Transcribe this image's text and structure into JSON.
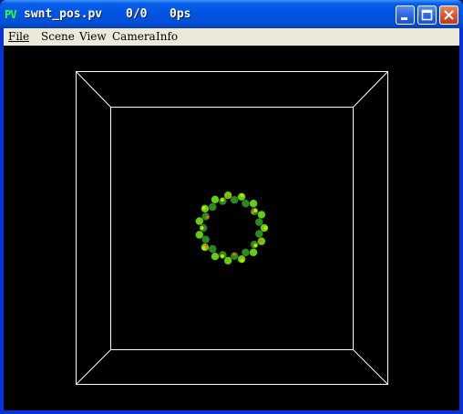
{
  "window": {
    "app_icon_text": "PV",
    "title": "swnt_pos.pv",
    "frame": "0/0",
    "time": "0ps"
  },
  "menu": {
    "items": [
      {
        "label": "File"
      },
      {
        "label": "Scene"
      },
      {
        "label": "View"
      },
      {
        "label": "Camera"
      },
      {
        "label": "Info"
      }
    ]
  },
  "scene": {
    "background_color": "#000000",
    "box_line_color": "#ffffff",
    "atom_colors": [
      "#2a8a1a",
      "#66cc11",
      "#c8e000",
      "#ff6a00"
    ]
  }
}
